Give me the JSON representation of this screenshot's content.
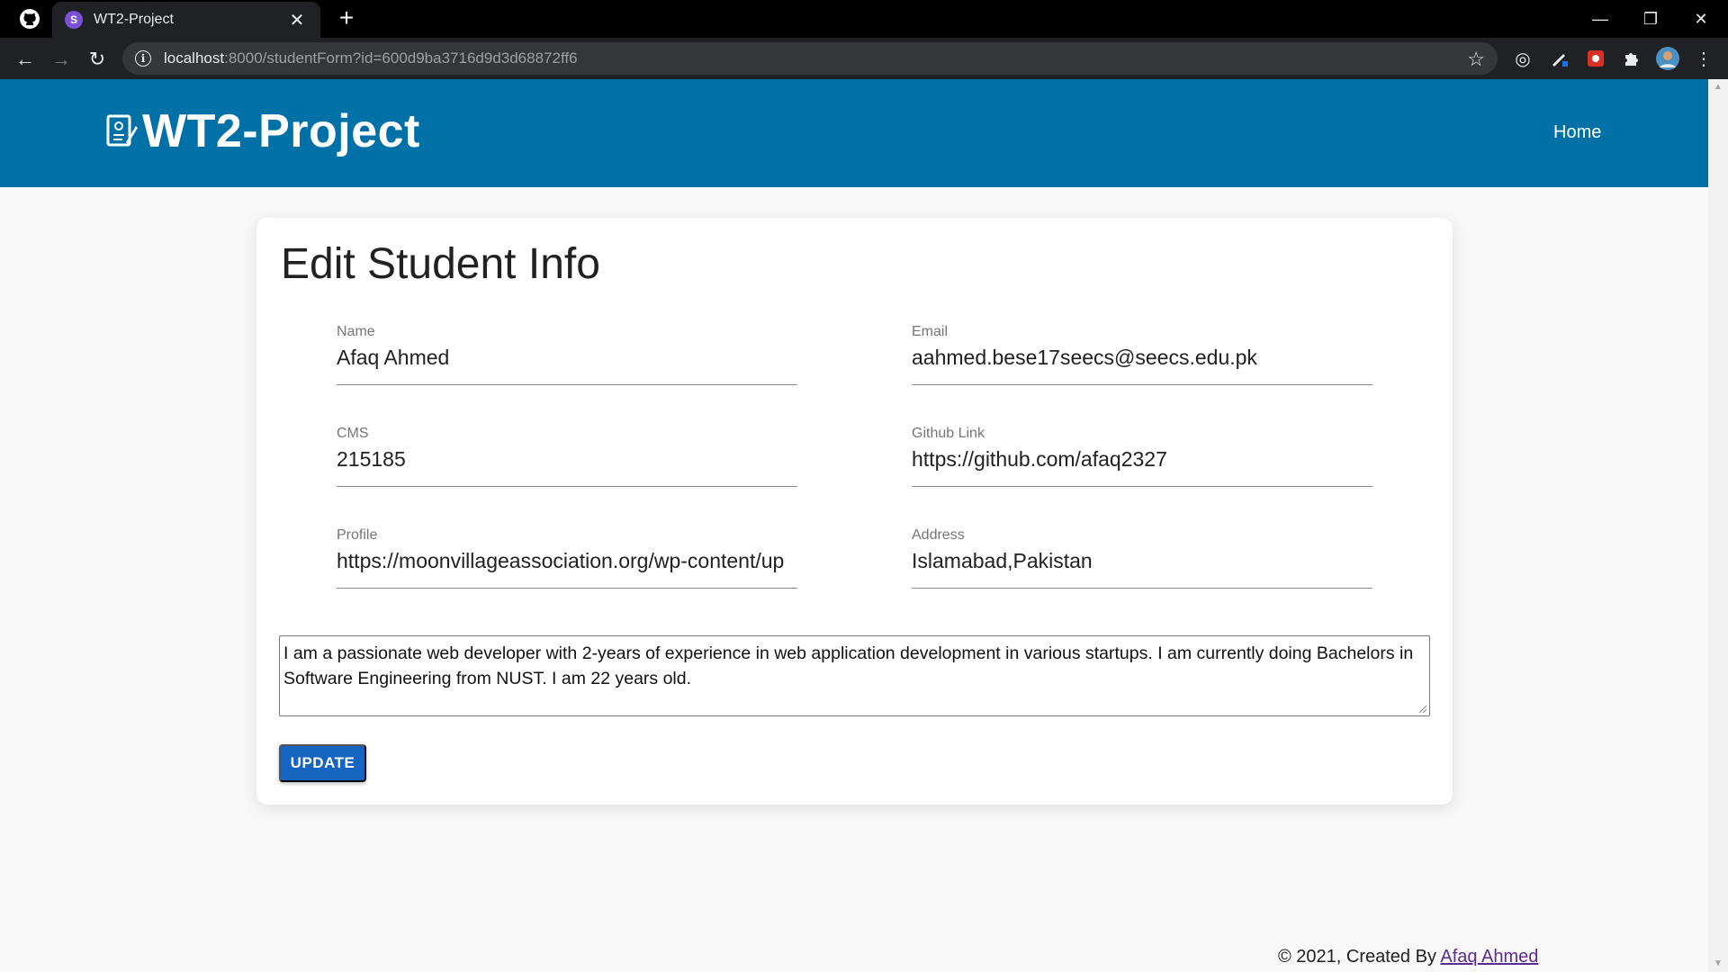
{
  "browser": {
    "tab_title": "WT2-Project",
    "tab_favicon_letter": "S",
    "url_host": "localhost",
    "url_path": ":8000/studentForm?id=600d9ba3716d9d3d68872ff6",
    "window_controls": {
      "minimize": "—",
      "restore": "❐",
      "close": "✕"
    },
    "toolbar_icons": [
      "back-icon",
      "forward-icon",
      "reload-icon",
      "info-icon",
      "star-icon",
      "extension-target-icon",
      "extension-pen-icon",
      "extension-red-icon",
      "puzzle-icon",
      "profile-avatar",
      "more-menu-icon"
    ]
  },
  "header": {
    "brand": "WT2-Project",
    "nav": {
      "home": "Home"
    }
  },
  "form": {
    "title": "Edit Student Info",
    "fields": {
      "name": {
        "label": "Name",
        "value": "Afaq Ahmed"
      },
      "email": {
        "label": "Email",
        "value": "aahmed.bese17seecs@seecs.edu.pk"
      },
      "cms": {
        "label": "CMS",
        "value": "215185"
      },
      "github": {
        "label": "Github Link",
        "value": "https://github.com/afaq2327"
      },
      "profile": {
        "label": "Profile",
        "value": "https://moonvillageassociation.org/wp-content/up"
      },
      "address": {
        "label": "Address",
        "value": "Islamabad,Pakistan"
      }
    },
    "bio": "I am a passionate web developer with 2-years of experience in web application development in various startups. I am currently doing Bachelors in Software Engineering from NUST. I am 22 years old.",
    "submit_label": "UPDATE"
  },
  "footer": {
    "prefix": "© 2021, Created By ",
    "author": "Afaq Ahmed"
  },
  "colors": {
    "header_bg": "#0071a6",
    "button_bg": "#1565c0",
    "page_bg": "#f8f8f8",
    "link": "#5b2c8f"
  }
}
